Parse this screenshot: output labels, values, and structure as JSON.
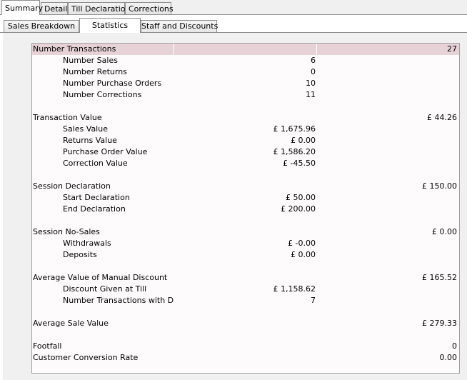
{
  "top_tabs": [
    {
      "label": "Summary",
      "active": true
    },
    {
      "label": "Detail",
      "active": false
    },
    {
      "label": "Till Declaration",
      "active": false
    },
    {
      "label": "Corrections",
      "active": false
    }
  ],
  "sub_tabs": [
    {
      "label": "Sales Breakdown",
      "active": false
    },
    {
      "label": "Statistics",
      "active": true
    },
    {
      "label": "Staff and Discounts",
      "active": false
    }
  ],
  "rows": [
    {
      "label": "Number Transactions",
      "level": 0,
      "mid": "",
      "right": "27",
      "header": true
    },
    {
      "label": "Number Sales",
      "level": 1,
      "mid": "6",
      "right": ""
    },
    {
      "label": "Number Returns",
      "level": 1,
      "mid": "0",
      "right": ""
    },
    {
      "label": "Number Purchase Orders",
      "level": 1,
      "mid": "10",
      "right": ""
    },
    {
      "label": "Number Corrections",
      "level": 1,
      "mid": "11",
      "right": ""
    },
    {
      "label": "",
      "level": 0,
      "mid": "",
      "right": ""
    },
    {
      "label": "Transaction Value",
      "level": 0,
      "mid": "",
      "right": "£ 44.26"
    },
    {
      "label": "Sales Value",
      "level": 1,
      "mid": "£ 1,675.96",
      "right": ""
    },
    {
      "label": "Returns Value",
      "level": 1,
      "mid": "£ 0.00",
      "right": ""
    },
    {
      "label": "Purchase Order Value",
      "level": 1,
      "mid": "£ 1,586.20",
      "right": ""
    },
    {
      "label": "Correction Value",
      "level": 1,
      "mid": "£ -45.50",
      "right": ""
    },
    {
      "label": "",
      "level": 0,
      "mid": "",
      "right": ""
    },
    {
      "label": "Session Declaration",
      "level": 0,
      "mid": "",
      "right": "£ 150.00"
    },
    {
      "label": "Start Declaration",
      "level": 1,
      "mid": "£ 50.00",
      "right": ""
    },
    {
      "label": "End Declaration",
      "level": 1,
      "mid": "£ 200.00",
      "right": ""
    },
    {
      "label": "",
      "level": 0,
      "mid": "",
      "right": ""
    },
    {
      "label": "Session No-Sales",
      "level": 0,
      "mid": "",
      "right": "£ 0.00"
    },
    {
      "label": "Withdrawals",
      "level": 1,
      "mid": "£ -0.00",
      "right": ""
    },
    {
      "label": "Deposits",
      "level": 1,
      "mid": "£ 0.00",
      "right": ""
    },
    {
      "label": "",
      "level": 0,
      "mid": "",
      "right": ""
    },
    {
      "label": "Average Value of Manual Discount",
      "level": 0,
      "mid": "",
      "right": "£ 165.52"
    },
    {
      "label": "Discount Given at Till",
      "level": 1,
      "mid": "£ 1,158.62",
      "right": ""
    },
    {
      "label": "Number Transactions with Dis...",
      "level": 1,
      "mid": "7",
      "right": ""
    },
    {
      "label": "",
      "level": 0,
      "mid": "",
      "right": ""
    },
    {
      "label": "Average Sale Value",
      "level": 0,
      "mid": "",
      "right": "£ 279.33"
    },
    {
      "label": "",
      "level": 0,
      "mid": "",
      "right": ""
    },
    {
      "label": "Footfall",
      "level": 0,
      "mid": "",
      "right": "0"
    },
    {
      "label": "Customer Conversion Rate",
      "level": 0,
      "mid": "",
      "right": "0.00"
    }
  ]
}
